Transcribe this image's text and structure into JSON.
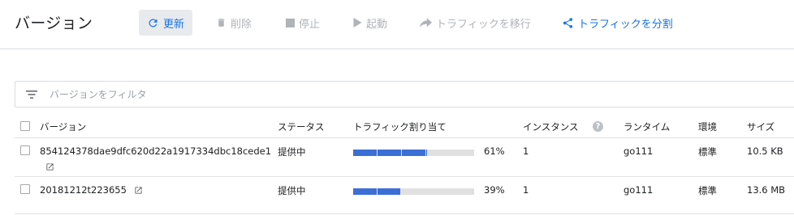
{
  "header": {
    "title": "バージョン",
    "buttons": {
      "refresh": "更新",
      "delete": "削除",
      "stop": "停止",
      "start": "起動",
      "migrate": "トラフィックを移行",
      "split": "トラフィックを分割"
    }
  },
  "filter": {
    "placeholder": "バージョンをフィルタ"
  },
  "table": {
    "headers": {
      "version": "バージョン",
      "status": "ステータス",
      "traffic": "トラフィック割り当て",
      "instances": "インスタンス",
      "runtime": "ランタイム",
      "env": "環境",
      "size": "サイズ"
    },
    "rows": [
      {
        "version": "854124378dae9dfc620d22a1917334dbc18cede1",
        "status": "提供中",
        "traffic_percent": "61%",
        "traffic_fraction": 0.61,
        "instances": "1",
        "runtime": "go111",
        "env": "標準",
        "size": "10.5 KB"
      },
      {
        "version": "20181212t223655",
        "status": "提供中",
        "traffic_percent": "39%",
        "traffic_fraction": 0.39,
        "instances": "1",
        "runtime": "go111",
        "env": "標準",
        "size": "13.6 MB"
      }
    ]
  },
  "colors": {
    "accent": "#1a73e8",
    "bar_fill": "#3b6fd6",
    "bar_track": "#e0e0e0",
    "disabled": "#b0b3b8"
  }
}
